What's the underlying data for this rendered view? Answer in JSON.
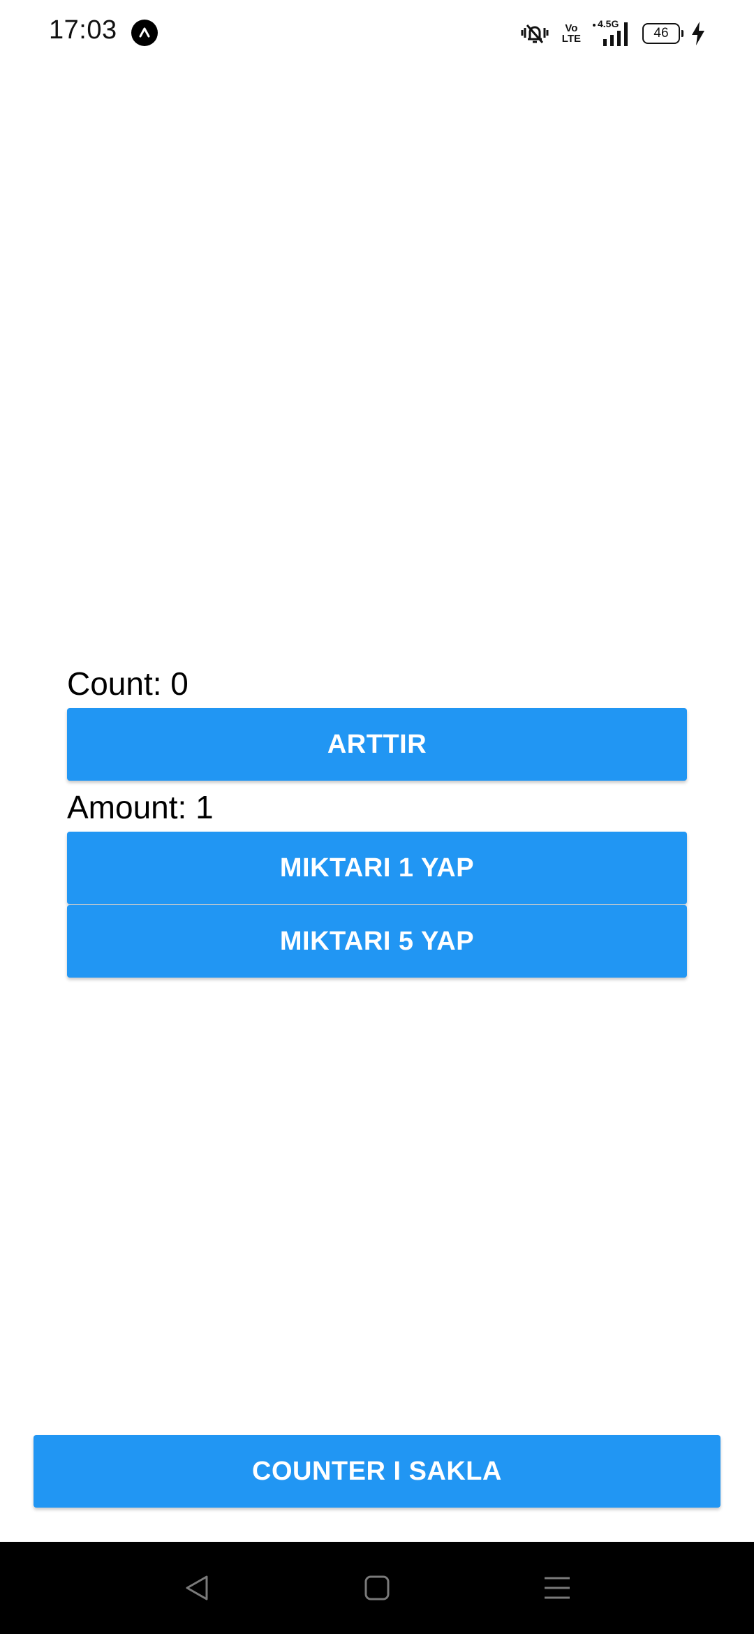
{
  "status_bar": {
    "time": "17:03",
    "network_type": "4.5G",
    "volte_top": "Vo",
    "volte_bottom": "LTE",
    "battery_level": "46",
    "icons": [
      "app-notification-icon",
      "mute-vibrate-icon",
      "volte-icon",
      "signal-icon",
      "battery-icon",
      "charging-icon"
    ]
  },
  "main": {
    "count_label": "Count: 0",
    "increment_button": "ARTTIR",
    "amount_label": "Amount: 1",
    "set_amount_1_button": "MIKTARI 1 YAP",
    "set_amount_5_button": "MIKTARI 5 YAP"
  },
  "footer": {
    "hide_counter_button": "COUNTER I SAKLA"
  },
  "navigation": {
    "icons": [
      "back-icon",
      "home-icon",
      "menu-icon"
    ]
  },
  "colors": {
    "button_primary": "#2196F3",
    "button_text": "#FFFFFF",
    "background": "#FFFFFF",
    "nav_bar": "#000000"
  }
}
